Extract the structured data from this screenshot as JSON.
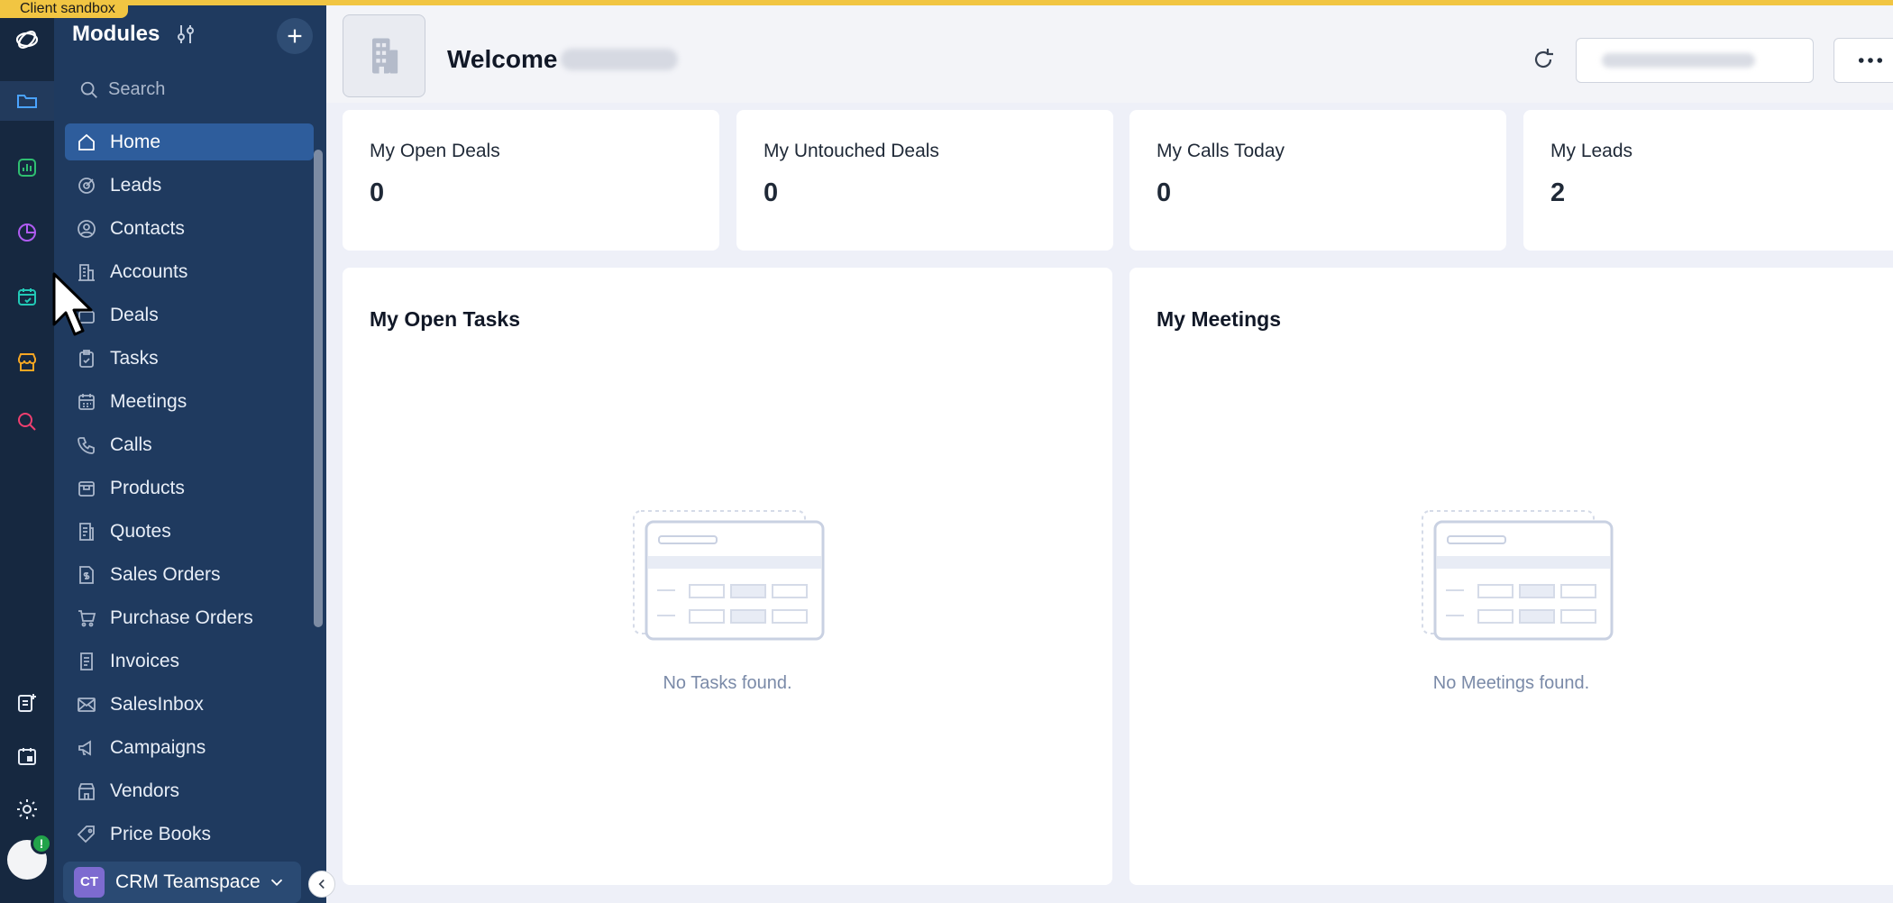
{
  "sandbox": {
    "label": "Client sandbox"
  },
  "sidebar": {
    "title": "Modules",
    "search_placeholder": "Search",
    "items": [
      {
        "label": "Home",
        "icon": "home-icon",
        "active": true
      },
      {
        "label": "Leads",
        "icon": "target-icon"
      },
      {
        "label": "Contacts",
        "icon": "contact-icon"
      },
      {
        "label": "Accounts",
        "icon": "building-icon"
      },
      {
        "label": "Deals",
        "icon": "briefcase-icon"
      },
      {
        "label": "Tasks",
        "icon": "task-icon"
      },
      {
        "label": "Meetings",
        "icon": "calendar-icon"
      },
      {
        "label": "Calls",
        "icon": "phone-icon"
      },
      {
        "label": "Products",
        "icon": "box-icon"
      },
      {
        "label": "Quotes",
        "icon": "quote-icon"
      },
      {
        "label": "Sales Orders",
        "icon": "dollar-doc-icon"
      },
      {
        "label": "Purchase Orders",
        "icon": "cart-icon"
      },
      {
        "label": "Invoices",
        "icon": "invoice-icon"
      },
      {
        "label": "SalesInbox",
        "icon": "mail-icon"
      },
      {
        "label": "Campaigns",
        "icon": "megaphone-icon"
      },
      {
        "label": "Vendors",
        "icon": "store-icon"
      },
      {
        "label": "Price Books",
        "icon": "tag-icon"
      }
    ],
    "teamspace": {
      "initials": "CT",
      "label": "CRM Teamspace"
    }
  },
  "header": {
    "welcome": "Welcome"
  },
  "stats": [
    {
      "label": "My Open Deals",
      "value": "0"
    },
    {
      "label": "My Untouched Deals",
      "value": "0"
    },
    {
      "label": "My Calls Today",
      "value": "0"
    },
    {
      "label": "My Leads",
      "value": "2"
    }
  ],
  "panels": [
    {
      "title": "My Open Tasks",
      "empty": "No Tasks found."
    },
    {
      "title": "My Meetings",
      "empty": "No Meetings found."
    }
  ],
  "colors": {
    "rail": "#162840",
    "panel": "#1f3a5f",
    "active": "#2e5d9c",
    "sandbox": "#f1c542"
  }
}
